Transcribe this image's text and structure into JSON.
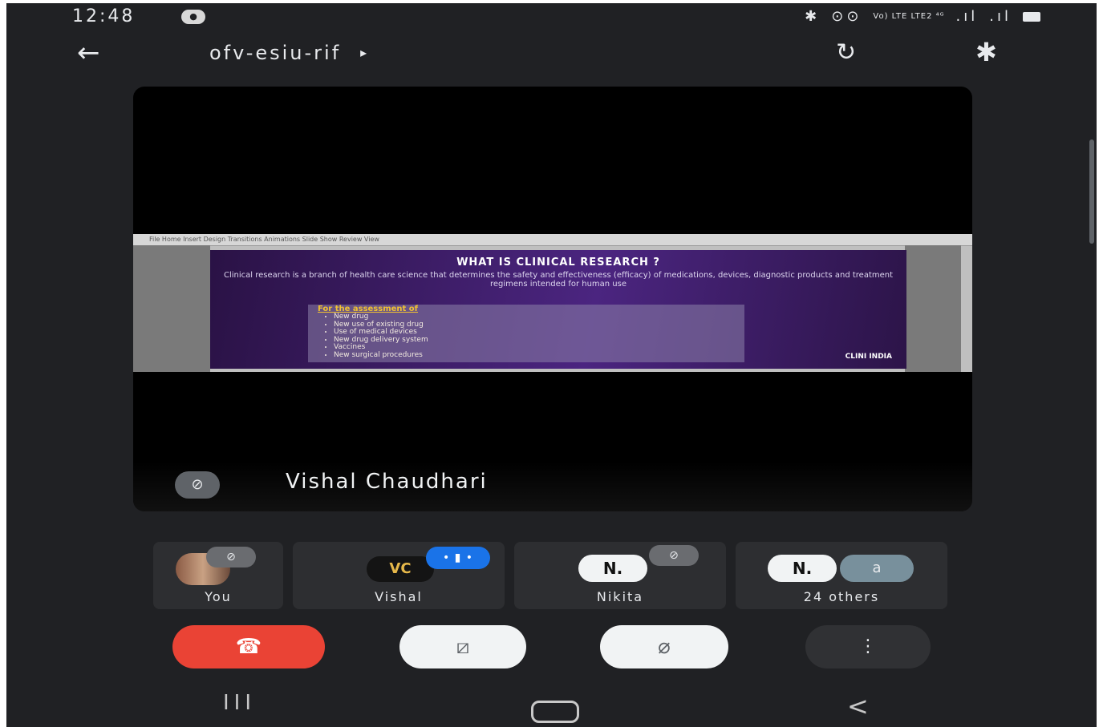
{
  "status_bar": {
    "time": "12:48",
    "notification_badge": "●",
    "network_small": "Vo) LTE\nLTE2 ⁴ᴳ",
    "icons": [
      "bluetooth-icon",
      "vowifi-icon",
      "signal-icon",
      "signal-icon",
      "battery-icon"
    ]
  },
  "app_bar": {
    "back_icon": "←",
    "meeting_code": "ofv-esiu-rif",
    "expand_icon": "▸",
    "flip_camera_icon": "↻",
    "bluetooth_icon": "✱"
  },
  "stage": {
    "slide": {
      "toolbar_text": "File  Home  Insert  Design  Transitions  Animations  Slide Show  Review  View",
      "title": "WHAT IS CLINICAL RESEARCH ?",
      "body": "Clinical research is a branch of health care science that determines the safety and effectiveness (efficacy) of medications, devices, diagnostic products and treatment regimens intended for human use",
      "assessment_heading": "For the assessment of",
      "assessment_items": [
        "New drug",
        "New use of existing drug",
        "Use of medical devices",
        "New drug delivery system",
        "Vaccines",
        "New surgical procedures"
      ],
      "logo_text": "CLINI INDIA"
    },
    "presenter_mic_icon": "̸🎙",
    "presenter_name": "Vishal Chaudhari"
  },
  "tiles": [
    {
      "label": "You",
      "muted": true
    },
    {
      "label": "Vishal",
      "initials": "VC",
      "speaking": true,
      "speaking_glyph": "• ▮ •"
    },
    {
      "label": "Nikita",
      "initials": "N.",
      "muted": true
    },
    {
      "label": "24 others",
      "initials": "N.",
      "extra_initial": "a"
    }
  ],
  "controls": {
    "end_call_icon": "☎",
    "camera_off_icon": "⧄",
    "mic_off_icon": "⌀",
    "more_icon": "⋮"
  },
  "nav_bar": {
    "recent_icon": "III",
    "back_icon": "<"
  },
  "colors": {
    "background": "#202124",
    "end_call": "#ea4335",
    "speaking": "#1a73e8",
    "slide_title_accent": "#f1c232"
  }
}
